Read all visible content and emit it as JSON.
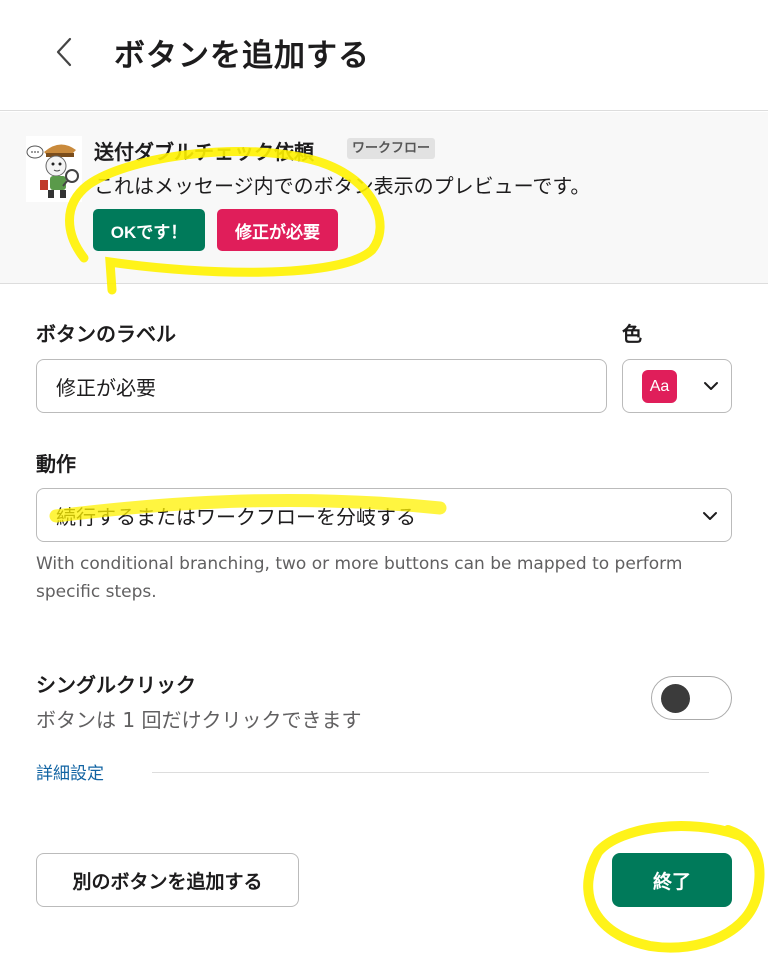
{
  "header": {
    "title": "ボタンを追加する",
    "back_icon": "chevron-left-icon"
  },
  "preview": {
    "workflow_name": "送付ダブルチェック依頼",
    "badge": "ワークフロー",
    "message": "これはメッセージ内でのボタン表示のプレビューです。",
    "buttons": [
      {
        "label": "OKです！",
        "color": "#007a5a"
      },
      {
        "label": "修正が必要",
        "color": "#e01e5a"
      }
    ]
  },
  "form": {
    "label_title": "ボタンのラベル",
    "label_value": "修正が必要",
    "color_title": "色",
    "color_swatch_text": "Aa",
    "color_value": "#e01e5a",
    "action_title": "動作",
    "action_value": "続行するまたはワークフローを分岐する",
    "helper_text": "With conditional branching, two or more buttons can be mapped to perform specific steps.",
    "single_click_title": "シングルクリック",
    "single_click_desc": "ボタンは 1 回だけクリックできます",
    "single_click_enabled": false,
    "advanced_link": "詳細設定"
  },
  "footer": {
    "add_button": "別のボタンを追加する",
    "done_button": "終了"
  },
  "colors": {
    "accent_green": "#007a5a",
    "accent_red": "#e01e5a",
    "link": "#1264a3",
    "highlight": "#fff200"
  }
}
